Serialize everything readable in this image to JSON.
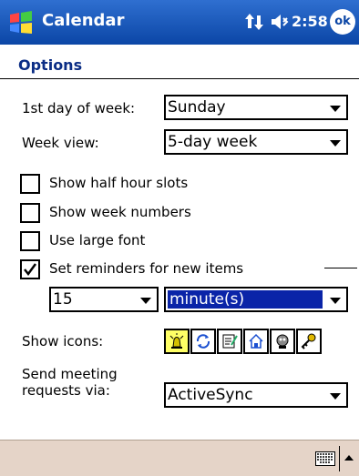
{
  "titlebar": {
    "app_title": "Calendar",
    "time": "2:58",
    "ok_label": "ok"
  },
  "page": {
    "heading": "Options"
  },
  "options": {
    "first_day_label": "1st day of week:",
    "first_day_value": "Sunday",
    "week_view_label": "Week view:",
    "week_view_value": "5-day week",
    "half_hour_label": "Show half hour slots",
    "half_hour_checked": false,
    "week_numbers_label": "Show week numbers",
    "week_numbers_checked": false,
    "large_font_label": "Use large font",
    "large_font_checked": false,
    "reminders_label": "Set reminders for new items",
    "reminders_checked": true,
    "reminder_amount": "15",
    "reminder_unit": "minute(s)",
    "show_icons_label": "Show icons:",
    "icons": [
      "alarm-icon",
      "recurring-icon",
      "notes-icon",
      "home-icon",
      "private-icon",
      "key-icon"
    ],
    "send_meeting_label_1": "Send meeting",
    "send_meeting_label_2": "requests via:",
    "send_meeting_value": "ActiveSync"
  },
  "colors": {
    "titlebar": "#0b46a6",
    "heading": "#0b2d85",
    "selection": "#0a24a8",
    "bottombar": "#e5d4c8"
  }
}
